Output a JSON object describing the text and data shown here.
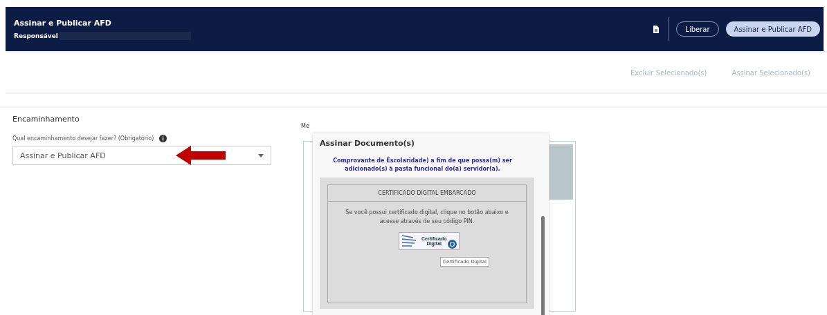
{
  "header": {
    "title": "Assinar e Publicar AFD",
    "subtitle": "Responsável",
    "buttons": [
      {
        "label": "Liberar",
        "kind": "outline"
      },
      {
        "label": "Assinar e Publicar AFD",
        "kind": "filled"
      }
    ]
  },
  "actions": [
    {
      "label": "Excluir Selecionado(s)",
      "disabled": true
    },
    {
      "label": "Assinar Selecionado(s)",
      "disabled": true
    }
  ],
  "routing": {
    "title": "Encaminhamento",
    "question": "Qual encaminhamento desejar fazer? (Obrigatório)",
    "value": "Assinar e Publicar AFD",
    "message_label": "Me"
  },
  "modal": {
    "title": "Assinar Documento(s)",
    "text_lines": [
      "Comprovante de Escolaridade) a fim de que possa(m) ser",
      "adicionado(s) à pasta funcional do(a) servidor(a)."
    ],
    "cert_title": "CERTIFICADO DIGITAL EMBARCADO",
    "cert_text": "Se você possui certificado digital, clique no botão abaixo e acesse através de seu código PIN.",
    "cert_button": [
      "Certificado",
      "Digital"
    ],
    "tooltip": "Certificado Digital"
  }
}
